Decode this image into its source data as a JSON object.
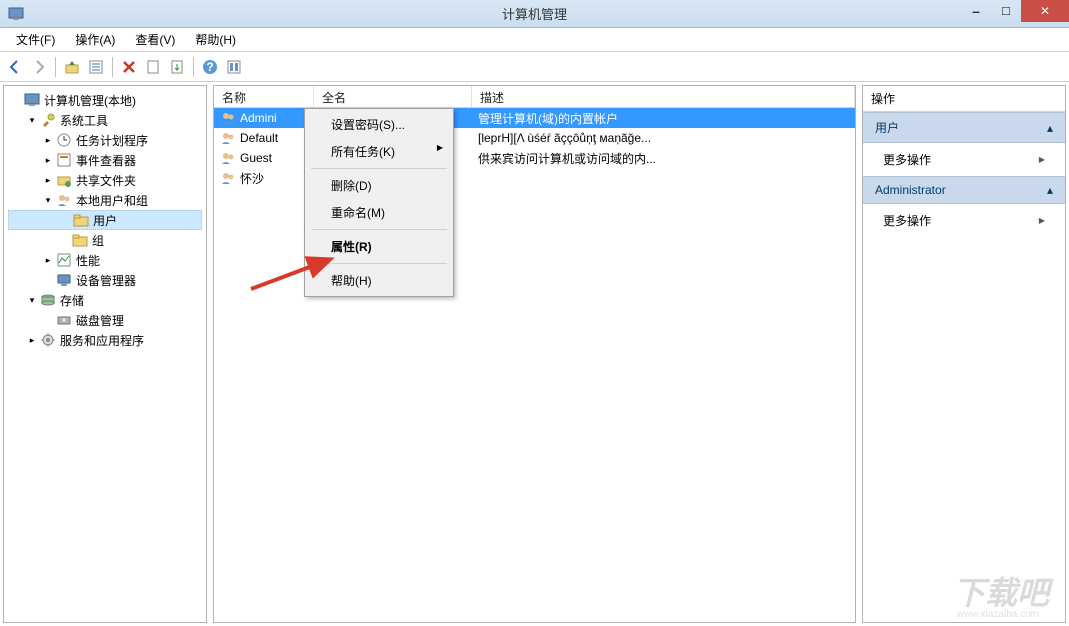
{
  "window": {
    "title": "计算机管理"
  },
  "menu": {
    "file": "文件(F)",
    "action": "操作(A)",
    "view": "查看(V)",
    "help": "帮助(H)"
  },
  "tree": [
    {
      "indent": 0,
      "exp": "",
      "label": "计算机管理(本地)",
      "icon": "comp"
    },
    {
      "indent": 1,
      "exp": "▾",
      "label": "系统工具",
      "icon": "tools"
    },
    {
      "indent": 2,
      "exp": "▸",
      "label": "任务计划程序",
      "icon": "sched"
    },
    {
      "indent": 2,
      "exp": "▸",
      "label": "事件查看器",
      "icon": "event"
    },
    {
      "indent": 2,
      "exp": "▸",
      "label": "共享文件夹",
      "icon": "share"
    },
    {
      "indent": 2,
      "exp": "▾",
      "label": "本地用户和组",
      "icon": "users"
    },
    {
      "indent": 3,
      "exp": "",
      "label": "用户",
      "icon": "folder",
      "selected": true
    },
    {
      "indent": 3,
      "exp": "",
      "label": "组",
      "icon": "folder"
    },
    {
      "indent": 2,
      "exp": "▸",
      "label": "性能",
      "icon": "perf"
    },
    {
      "indent": 2,
      "exp": "",
      "label": "设备管理器",
      "icon": "dev"
    },
    {
      "indent": 1,
      "exp": "▾",
      "label": "存储",
      "icon": "storage"
    },
    {
      "indent": 2,
      "exp": "",
      "label": "磁盘管理",
      "icon": "disk"
    },
    {
      "indent": 1,
      "exp": "▸",
      "label": "服务和应用程序",
      "icon": "svc"
    }
  ],
  "list": {
    "headers": {
      "name": "名称",
      "full": "全名",
      "desc": "描述"
    },
    "rows": [
      {
        "name": "Admini",
        "full": "",
        "desc": "管理计算机(域)的内置帐户",
        "selected": true
      },
      {
        "name": "Default",
        "full": "",
        "desc": "[leprH][Λ ùśéŕ ãççôůņţ мaņãğe..."
      },
      {
        "name": "Guest",
        "full": "",
        "desc": "供来宾访问计算机或访问域的内..."
      },
      {
        "name": "怀沙",
        "full": "",
        "desc": ""
      }
    ]
  },
  "context_menu": [
    {
      "label": "设置密码(S)...",
      "type": "item"
    },
    {
      "label": "所有任务(K)",
      "type": "sub"
    },
    {
      "type": "sep"
    },
    {
      "label": "删除(D)",
      "type": "item"
    },
    {
      "label": "重命名(M)",
      "type": "item"
    },
    {
      "type": "sep"
    },
    {
      "label": "属性(R)",
      "type": "item",
      "bold": true
    },
    {
      "type": "sep"
    },
    {
      "label": "帮助(H)",
      "type": "item"
    }
  ],
  "actions": {
    "title": "操作",
    "group1": "用户",
    "more1": "更多操作",
    "group2": "Administrator",
    "more2": "更多操作"
  },
  "watermark": {
    "text": "下载吧",
    "url": "www.xiazaiba.com"
  }
}
